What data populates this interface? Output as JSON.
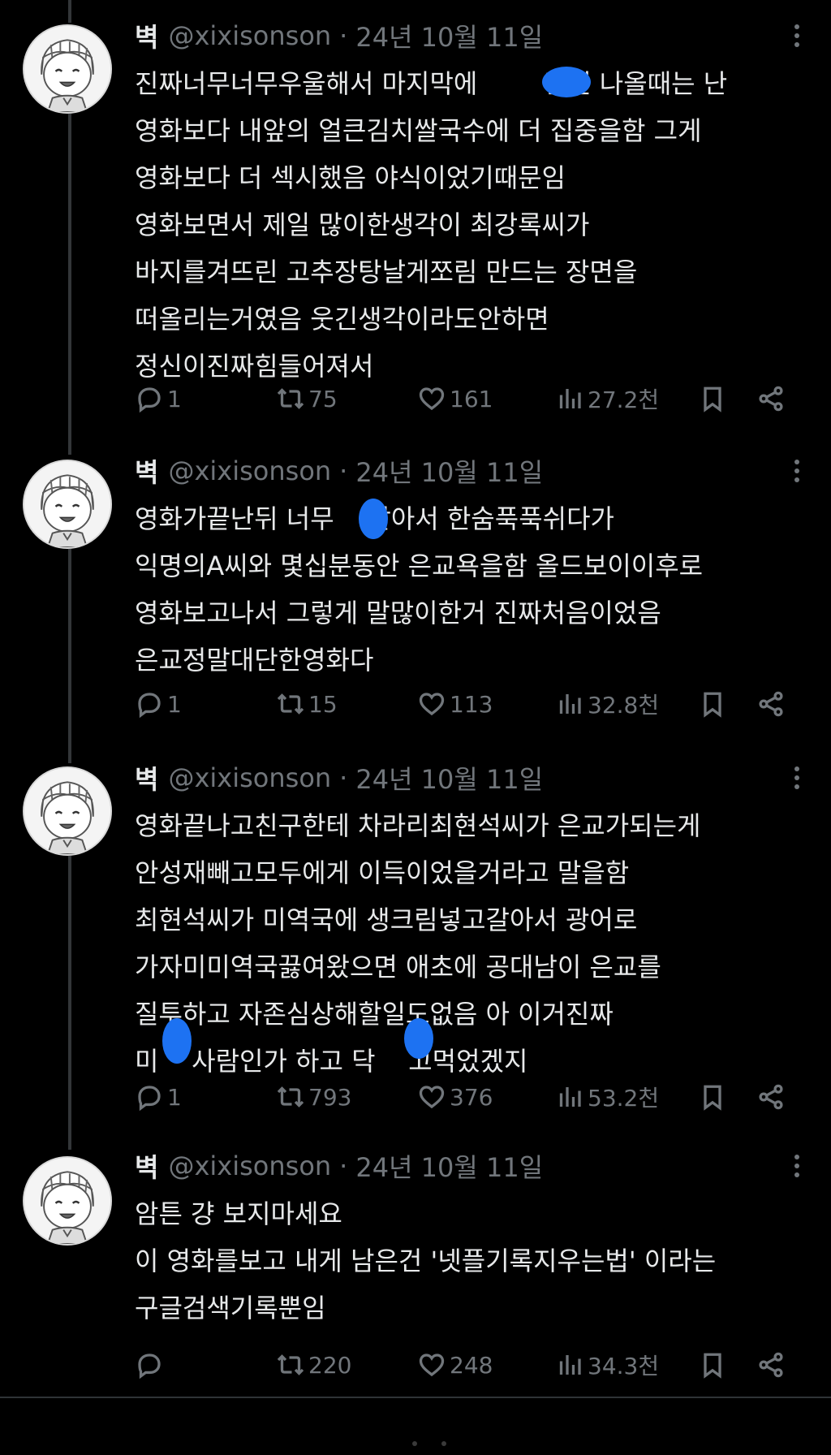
{
  "tweets": [
    {
      "name": "벽",
      "handle": "@xixisonson",
      "sep": "·",
      "date": "24년 10월 11일",
      "lines": [
        "진짜너무너무우울해서 마지막에        긴씬 나올때는 난",
        "영화보다 내앞의 얼큰김치쌀국수에 더 집중을함 그게",
        "영화보다 더 섹시했음 야식이었기때문임",
        "영화보면서 제일 많이한생각이 최강록씨가",
        "바지를겨뜨린 고추장탕날게쪼림 만드는 장면을",
        "떠올리는거였음 웃긴생각이라도안하면",
        "정신이진짜힘들어져서"
      ],
      "replies": "1",
      "retweets": "75",
      "likes": "161",
      "views": "27.2천"
    },
    {
      "name": "벽",
      "handle": "@xixisonson",
      "sep": "·",
      "date": "24년 10월 11일",
      "lines": [
        "영화가끝난뒤 너무    같아서 한숨푹푹쉬다가",
        "익명의A씨와 몇십분동안 은교욕을함 올드보이이후로",
        "영화보고나서 그렇게 말많이한거 진짜처음이었음",
        "은교정말대단한영화다"
      ],
      "replies": "1",
      "retweets": "15",
      "likes": "113",
      "views": "32.8천"
    },
    {
      "name": "벽",
      "handle": "@xixisonson",
      "sep": "·",
      "date": "24년 10월 11일",
      "lines": [
        "영화끝나고친구한테 차라리최현석씨가 은교가되는게",
        "안성재빼고모두에게 이득이었을거라고 말을함",
        "최현석씨가 미역국에 생크림넣고갈아서 광어로",
        "가자미미역국끓여왔으면 애초에 공대남이 은교를",
        "질투하고 자존심상해할일도없음 아 이거진짜",
        "미    사람인가 하고 닥    고먹었겠지"
      ],
      "replies": "1",
      "retweets": "793",
      "likes": "376",
      "views": "53.2천"
    },
    {
      "name": "벽",
      "handle": "@xixisonson",
      "sep": "·",
      "date": "24년 10월 11일",
      "lines": [
        "암튼 걍 보지마세요",
        "이 영화를보고 내게 남은건 '넷플기록지우는법' 이라는",
        "구글검색기록뿐임"
      ],
      "replies": "",
      "retweets": "220",
      "likes": "248",
      "views": "34.3천"
    }
  ],
  "icons": {
    "reply": "reply-icon",
    "retweet": "retweet-icon",
    "like": "heart-icon",
    "views": "views-icon",
    "bookmark": "bookmark-icon",
    "share": "share-icon",
    "more": "more-icon"
  },
  "colors": {
    "background": "#000000",
    "text": "#e7e9ea",
    "muted": "#71767b",
    "redaction": "#1d72f2"
  }
}
